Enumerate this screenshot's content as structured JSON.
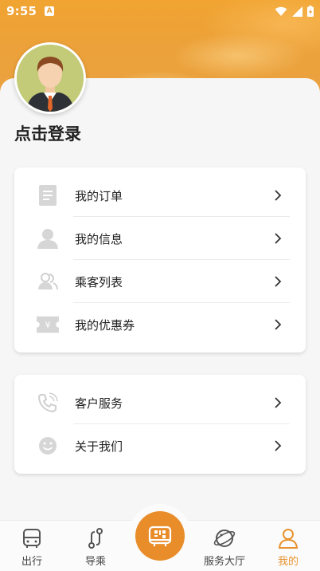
{
  "status_bar": {
    "time": "9:55",
    "notification_glyph": "A"
  },
  "profile": {
    "login_text": "点击登录"
  },
  "menu_group_1": {
    "items": [
      {
        "label": "我的订单",
        "icon": "document-icon"
      },
      {
        "label": "我的信息",
        "icon": "person-icon"
      },
      {
        "label": "乘客列表",
        "icon": "passengers-icon"
      },
      {
        "label": "我的优惠券",
        "icon": "coupon-icon"
      }
    ]
  },
  "menu_group_2": {
    "items": [
      {
        "label": "客户服务",
        "icon": "phone-icon"
      },
      {
        "label": "关于我们",
        "icon": "smile-icon"
      }
    ]
  },
  "tabbar": {
    "tabs": [
      {
        "label": "出行",
        "icon": "bus-icon"
      },
      {
        "label": "导乘",
        "icon": "route-icon"
      },
      {
        "label": "",
        "icon": "qr-bus-icon"
      },
      {
        "label": "服务大厅",
        "icon": "planet-icon"
      },
      {
        "label": "我的",
        "icon": "user-icon"
      }
    ],
    "active": "我的",
    "accent_color": "#e8932f"
  },
  "colors": {
    "header": "#eca13a",
    "accent": "#e98d2b"
  }
}
